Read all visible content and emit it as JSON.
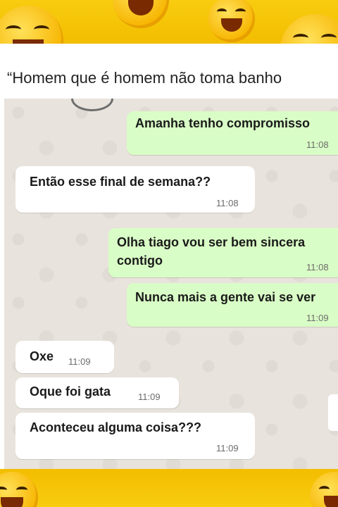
{
  "caption": "“Homem que é homem não toma banho",
  "messages": [
    {
      "direction": "out",
      "text": "Amanha tenho compromisso",
      "time": "11:08"
    },
    {
      "direction": "in",
      "text": "Então esse final de semana??",
      "time": "11:08"
    },
    {
      "direction": "out",
      "text_line1": "Olha tiago vou ser bem sincera",
      "text_line2": "contigo",
      "time": "11:08"
    },
    {
      "direction": "out",
      "text": "Nunca mais a gente vai se ver",
      "time": "11:09"
    },
    {
      "direction": "in",
      "text": "Oxe",
      "time": "11:09"
    },
    {
      "direction": "in",
      "text": "Oque foi gata",
      "time": "11:09"
    },
    {
      "direction": "in",
      "text": "Aconteceu alguma coisa???",
      "time": "11:09"
    }
  ],
  "colors": {
    "band": "#f6c400",
    "incoming_bubble": "#ffffff",
    "outgoing_bubble": "#d9fdc6",
    "chat_background": "#e8e3dc"
  },
  "icons": {
    "decor": "laughing-emoji-icon"
  }
}
